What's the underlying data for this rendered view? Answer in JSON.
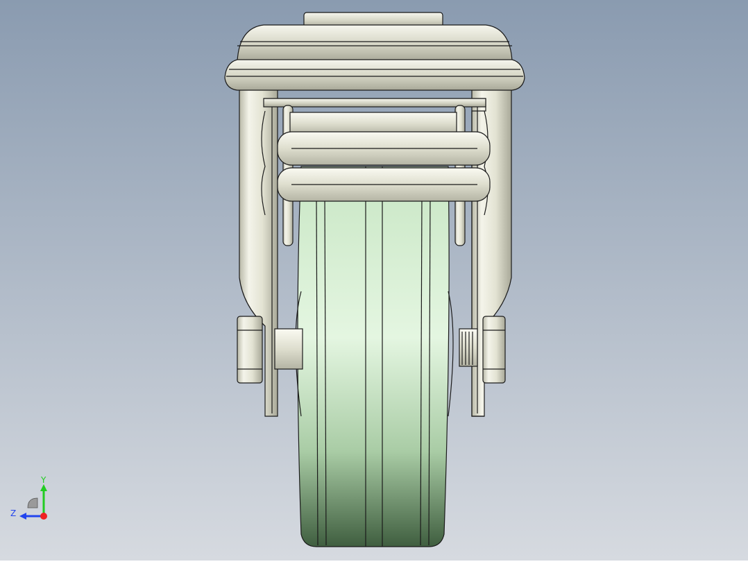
{
  "viewport": {
    "background_top": "#8a9bb0",
    "background_bottom": "#d4d8de"
  },
  "triad": {
    "y_label": "Y",
    "z_label": "Z",
    "y_color": "#22cc22",
    "z_color": "#2244ee",
    "x_color": "#ee2222"
  },
  "colors": {
    "metal": "#e6e6d8",
    "wheel": "#d9f0d6",
    "wheel_dark": "#4e6e4e",
    "outline": "#1a1a1a"
  }
}
